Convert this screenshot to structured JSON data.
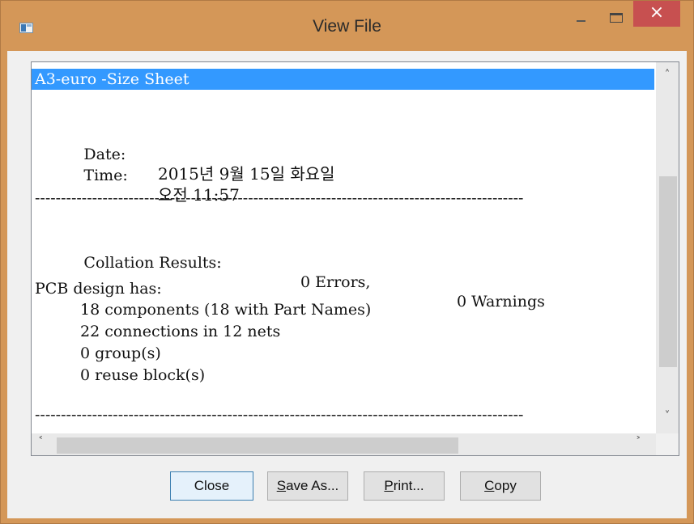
{
  "window": {
    "title": "View File"
  },
  "caption": {
    "close_glyph": "×"
  },
  "report": {
    "header": "A3-euro -Size Sheet",
    "date_label": "Date:",
    "date_value": "2015년 9월 15일 화요일",
    "time_label": "Time:",
    "time_value": "오전 11:57",
    "separator": "----------------------------------------------------------------------------------------------",
    "collation_label": "Collation Results:",
    "errors": "0 Errors,",
    "warnings": "0 Warnings",
    "pcb_heading": "PCB design has:",
    "pcb_items": [
      "18 components (18 with Part Names)",
      "22 connections in 12 nets",
      "0 group(s)",
      "0 reuse block(s)"
    ]
  },
  "buttons": {
    "close": "Close",
    "save_as_first": "S",
    "save_as_rest": "ave As...",
    "print_first": "P",
    "print_rest": "rint...",
    "copy_first": "C",
    "copy_rest": "opy"
  }
}
